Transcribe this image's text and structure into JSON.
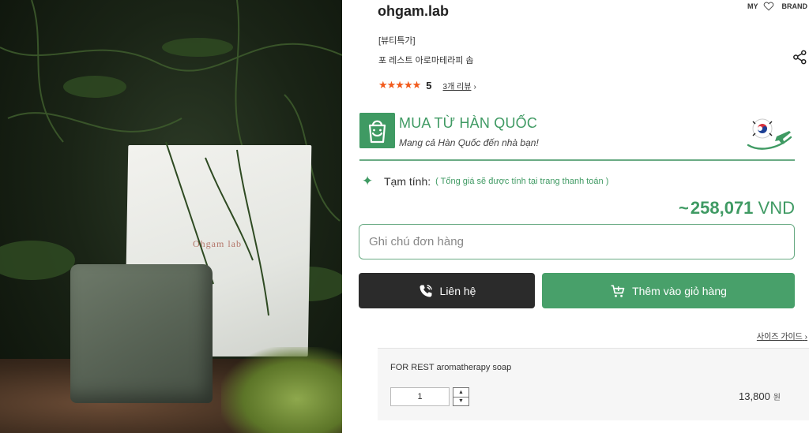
{
  "colors": {
    "accent": "#3f9a63",
    "star": "#f25a1b",
    "dark_button": "#2b2b2b",
    "green_button": "#48a06a"
  },
  "photo": {
    "package_text": "Ohgam lab"
  },
  "header": {
    "brand_name": "ohgam.lab",
    "nav": {
      "my": "MY",
      "brand": "BRAND"
    }
  },
  "product": {
    "category": "[뷰티특가]",
    "name": "포 레스트 아로마테라피 솝",
    "rating": {
      "stars": "★★★★★",
      "score": "5",
      "reviews_label": "3개 리뷰",
      "chevron": "›"
    }
  },
  "buy_banner": {
    "title": "MUA TỪ HÀN QUỐC",
    "subtitle": "Mang cả Hàn Quốc đến nhà bạn!"
  },
  "subtotal": {
    "label": "Tạm tính:",
    "note": "( Tổng giá sẽ được tính tại trang thanh toán )"
  },
  "total": {
    "prefix": "~",
    "amount": "258,071",
    "currency": "VND"
  },
  "order_note": {
    "placeholder": "Ghi chú đơn hàng"
  },
  "buttons": {
    "contact": "Liên hệ",
    "add_to_cart": "Thêm vào giỏ hàng"
  },
  "size_guide": {
    "label": "사이즈 가이드",
    "chevron": "›"
  },
  "option": {
    "name": "FOR REST aromatherapy soap",
    "quantity": "1",
    "price": "13,800",
    "currency": "원",
    "up": "▲",
    "down": "▼"
  }
}
